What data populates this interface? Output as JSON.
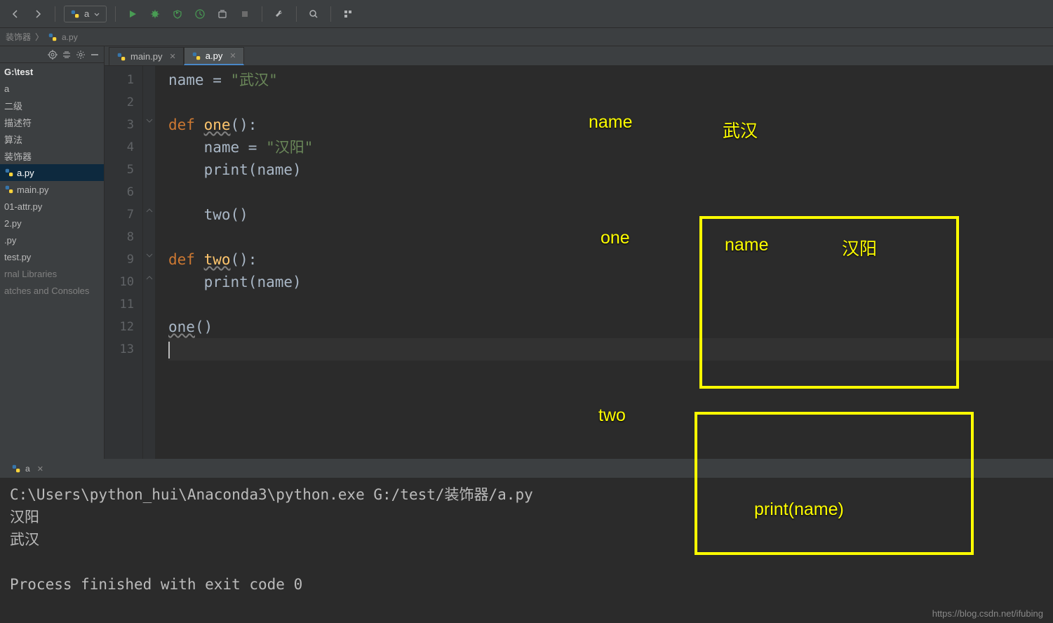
{
  "toolbar": {
    "run_config_label": "a"
  },
  "breadcrumb": {
    "item1": "装饰器",
    "item2": "a.py"
  },
  "tree": {
    "root": "G:\\test",
    "items": [
      "a",
      "二级",
      "描述符",
      "算法",
      "装饰器",
      "a.py",
      "main.py",
      "01-attr.py",
      "2.py",
      ".py",
      "test.py",
      "rnal Libraries",
      "atches and Consoles"
    ]
  },
  "tabs": [
    {
      "label": "main.py",
      "active": false
    },
    {
      "label": "a.py",
      "active": true
    }
  ],
  "code": {
    "lines": [
      {
        "n": "1",
        "segments": [
          {
            "t": "name = ",
            "c": ""
          },
          {
            "t": "\"武汉\"",
            "c": "str"
          }
        ]
      },
      {
        "n": "2",
        "segments": []
      },
      {
        "n": "3",
        "segments": [
          {
            "t": "def ",
            "c": "kw"
          },
          {
            "t": "one",
            "c": "fn wavy"
          },
          {
            "t": "():",
            "c": ""
          }
        ]
      },
      {
        "n": "4",
        "segments": [
          {
            "t": "    name = ",
            "c": ""
          },
          {
            "t": "\"汉阳\"",
            "c": "str"
          }
        ]
      },
      {
        "n": "5",
        "segments": [
          {
            "t": "    ",
            "c": ""
          },
          {
            "t": "print",
            "c": ""
          },
          {
            "t": "(name)",
            "c": ""
          }
        ]
      },
      {
        "n": "6",
        "segments": []
      },
      {
        "n": "7",
        "segments": [
          {
            "t": "    two()",
            "c": ""
          }
        ]
      },
      {
        "n": "8",
        "segments": []
      },
      {
        "n": "9",
        "segments": [
          {
            "t": "def ",
            "c": "kw"
          },
          {
            "t": "two",
            "c": "fn wavy"
          },
          {
            "t": "():",
            "c": ""
          }
        ]
      },
      {
        "n": "10",
        "segments": [
          {
            "t": "    ",
            "c": ""
          },
          {
            "t": "print",
            "c": ""
          },
          {
            "t": "(name)",
            "c": ""
          }
        ]
      },
      {
        "n": "11",
        "segments": []
      },
      {
        "n": "12",
        "segments": [
          {
            "t": "one",
            "c": "wavy"
          },
          {
            "t": "()",
            "c": ""
          }
        ]
      },
      {
        "n": "13",
        "segments": [],
        "current": true
      }
    ]
  },
  "annotations": {
    "name_label": "name",
    "wuhan": "武汉",
    "one_label": "one",
    "name2_label": "name",
    "hanyang": "汉阳",
    "two_label": "two",
    "print_name": "print(name)"
  },
  "run": {
    "tab_label": "a",
    "output": "C:\\Users\\python_hui\\Anaconda3\\python.exe G:/test/装饰器/a.py\n汉阳\n武汉\n\nProcess finished with exit code 0"
  },
  "watermark": "https://blog.csdn.net/ifubing"
}
